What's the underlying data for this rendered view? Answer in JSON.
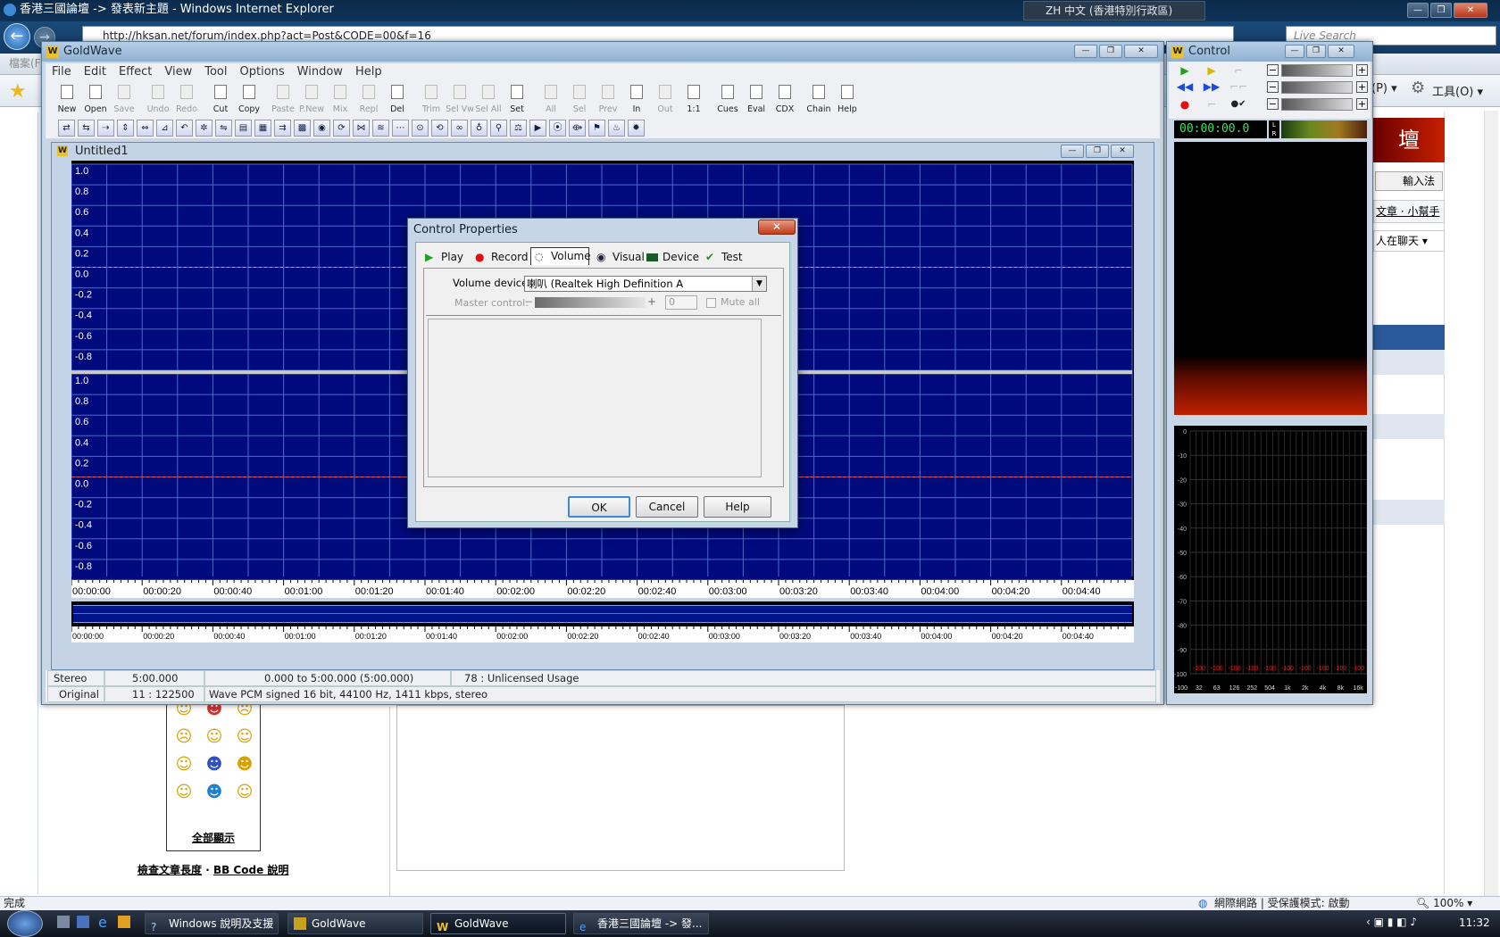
{
  "ie": {
    "title": "香港三國論壇 -> 發表新主題 - Windows Internet Explorer",
    "url": "http://hksan.net/forum/index.php?act=Post&CODE=00&f=16",
    "search_placeholder": "Live Search",
    "language_bar": "ZH 中文 (香港特別行政區)",
    "menu_partial": "檔案(F)",
    "tools_right": [
      "(P) ▾",
      "工具(O) ▾"
    ],
    "status_text": "完成",
    "zone_text": "網際網路 | 受保護模式: 啟動",
    "zoom": "100%"
  },
  "forum": {
    "input_method_label": "輸入法",
    "helper_links": "文章 · 小幫手",
    "chat_dropdown": "人在聊天",
    "logo_char": "壇",
    "show_all_link": "全部顯示",
    "check_length_link": "檢查文章長度",
    "bbcode_link": "BB Code 說明",
    "separator": "·"
  },
  "goldwave": {
    "title": "GoldWave",
    "menu": [
      "File",
      "Edit",
      "Effect",
      "View",
      "Tool",
      "Options",
      "Window",
      "Help"
    ],
    "toolbar": [
      {
        "label": "New",
        "enabled": true
      },
      {
        "label": "Open",
        "enabled": true
      },
      {
        "label": "Save",
        "enabled": false
      },
      {
        "label": "Undo",
        "enabled": false
      },
      {
        "label": "Redo",
        "enabled": false
      },
      {
        "label": "Cut",
        "enabled": true
      },
      {
        "label": "Copy",
        "enabled": true
      },
      {
        "label": "Paste",
        "enabled": false
      },
      {
        "label": "P.New",
        "enabled": false
      },
      {
        "label": "Mix",
        "enabled": false
      },
      {
        "label": "Repl",
        "enabled": false
      },
      {
        "label": "Del",
        "enabled": true
      },
      {
        "label": "Trim",
        "enabled": false
      },
      {
        "label": "Sel Vw",
        "enabled": false
      },
      {
        "label": "Sel All",
        "enabled": false
      },
      {
        "label": "Set",
        "enabled": true
      },
      {
        "label": "All",
        "enabled": false
      },
      {
        "label": "Sel",
        "enabled": false
      },
      {
        "label": "Prev",
        "enabled": false
      },
      {
        "label": "In",
        "enabled": true
      },
      {
        "label": "Out",
        "enabled": false
      },
      {
        "label": "1:1",
        "enabled": true
      },
      {
        "label": "Cues",
        "enabled": true
      },
      {
        "label": "Eval",
        "enabled": true
      },
      {
        "label": "CDX",
        "enabled": true
      },
      {
        "label": "Chain",
        "enabled": true
      },
      {
        "label": "Help",
        "enabled": true
      }
    ],
    "document_title": "Untitled1",
    "amplitude_labels_top": [
      "1.0",
      "0.8",
      "0.6",
      "0.4",
      "0.2",
      "0.0",
      "-0.2",
      "-0.4",
      "-0.6",
      "-0.8"
    ],
    "amplitude_labels_bottom": [
      "1.0",
      "0.8",
      "0.6",
      "0.4",
      "0.2",
      "0.0",
      "-0.2",
      "-0.4",
      "-0.6",
      "-0.8"
    ],
    "time_labels": [
      "00:00:00",
      "00:00:20",
      "00:00:40",
      "00:01:00",
      "00:01:20",
      "00:01:40",
      "00:02:00",
      "00:02:20",
      "00:02:40",
      "00:03:00",
      "00:03:20",
      "00:03:40",
      "00:04:00",
      "00:04:20",
      "00:04:40"
    ],
    "status": {
      "channels": "Stereo",
      "length": "5:00.000",
      "selection": "0.000 to 5:00.000 (5:00.000)",
      "license": "78 : Unlicensed Usage",
      "original": "Original",
      "ratio": "11 : 122500",
      "format": "Wave PCM signed 16 bit, 44100 Hz, 1411 kbps, stereo"
    },
    "colors": {
      "wave_bg": "#000a7c",
      "grid": "#4a6ac8",
      "center_line": "#c8c8c8"
    }
  },
  "dialog": {
    "title": "Control Properties",
    "tabs": [
      "Play",
      "Record",
      "Volume",
      "Visual",
      "Device",
      "Test"
    ],
    "selected_tab": "Volume",
    "volume_device_label": "Volume device:",
    "volume_device_value": "喇叭 (Realtek High Definition A",
    "master_control_label": "Master control:",
    "master_value": "0",
    "mute_all_label": "Mute all",
    "buttons": {
      "ok": "OK",
      "cancel": "Cancel",
      "help": "Help"
    }
  },
  "control": {
    "title": "Control",
    "time": "00:00:00.0",
    "meter_labels": [
      "L",
      "R"
    ],
    "db_labels": [
      "0",
      "-10",
      "-20",
      "-30",
      "-40",
      "-50",
      "-60",
      "-70",
      "-80",
      "-90",
      "-100"
    ],
    "freq_labels": [
      "32",
      "63",
      "126",
      "252",
      "504",
      "1k",
      "2k",
      "4k",
      "8k",
      "16k"
    ],
    "peak_values": "-100"
  },
  "taskbar": {
    "items": [
      "Windows 說明及支援",
      "GoldWave",
      "GoldWave",
      "香港三國論壇 -> 發..."
    ],
    "clock": "11:32"
  }
}
